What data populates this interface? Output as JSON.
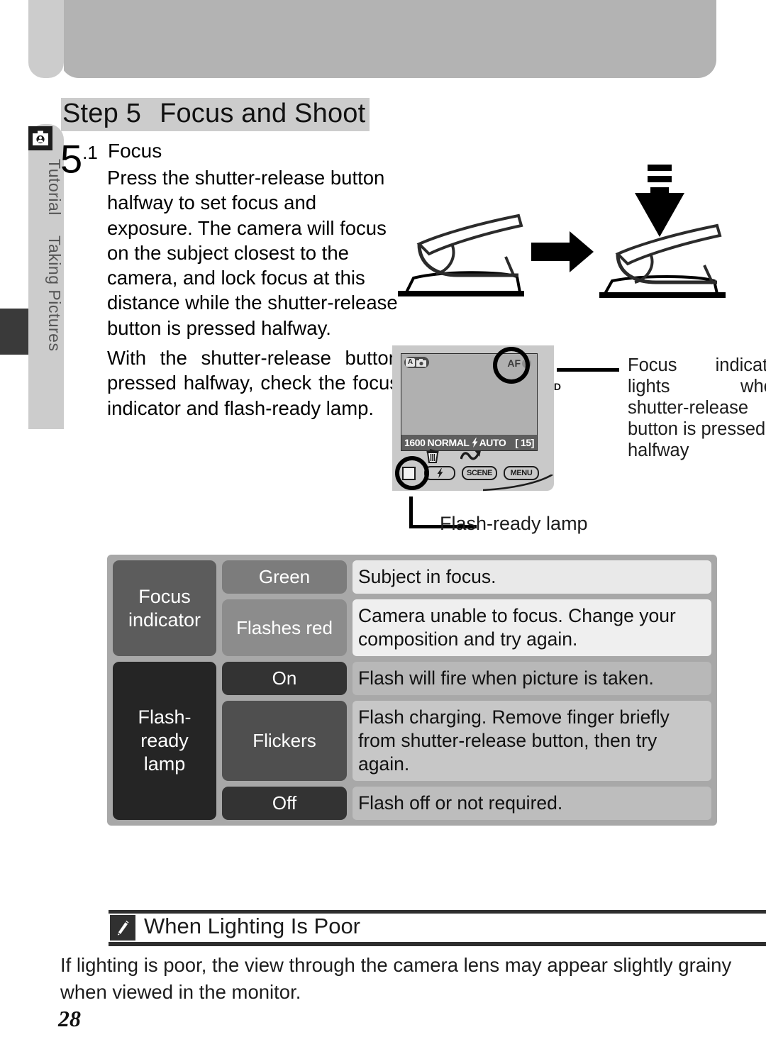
{
  "sidebar": {
    "camera_icon": "camera-icon",
    "labels": [
      "Tutorial",
      "Taking Pictures"
    ]
  },
  "step": {
    "header_label": "Step 5",
    "header_title": "Focus and Shoot",
    "number": "5",
    "number_sub": ".1",
    "title": "Focus",
    "paragraph1": "Press the shutter-release button halfway to set focus and exposure.  The camera will focus on the subject closest to the camera, and lock focus at this distance while the shutter-release button is pressed halfway.",
    "paragraph2": "With the shutter-release button pressed halfway, check the focus indicator and flash-ready lamp."
  },
  "camera": {
    "lcd": {
      "mode_badge_letter": "A",
      "mode_badge_icon": "camera-icon",
      "af_label": "AF",
      "af_dot": "focus-dot-icon",
      "right_marker": "D",
      "status": {
        "resolution": "1600",
        "quality": "NORMAL",
        "flash_icon": "flash-icon",
        "flash_mode": "AUTO",
        "frames_remaining": "[   15]"
      }
    },
    "buttons": {
      "monitor": "monitor-button",
      "flash": "flash-icon",
      "scene": "SCENE",
      "menu": "MENU",
      "trash": "trash-icon",
      "transfer": "transfer-icon"
    }
  },
  "callouts": {
    "focus_indicator": {
      "line1": "Focus indicator",
      "line2": "lights when",
      "line3": "shutter-release",
      "line4": "button is pressed",
      "line5": "halfway"
    },
    "flash_ready_lamp": "Flash-ready lamp"
  },
  "table": {
    "groups": [
      {
        "label": "Focus\nindicator",
        "label_line1": "Focus",
        "label_line2": "indicator",
        "rows": [
          {
            "state": "Green",
            "desc": "Subject in focus."
          },
          {
            "state": "Flashes red",
            "desc": "Camera unable to focus.  Change your composition and try again."
          }
        ]
      },
      {
        "label_line1": "Flash-",
        "label_line2": "ready",
        "label_line3": "lamp",
        "rows": [
          {
            "state": "On",
            "desc": "Flash will fire when picture is taken."
          },
          {
            "state": "Flickers",
            "desc": "Flash charging.  Remove finger briefly from shutter-release button, then try again."
          },
          {
            "state": "Off",
            "desc": "Flash off or not required."
          }
        ]
      }
    ]
  },
  "note": {
    "icon": "pencil-icon",
    "title": "When Lighting Is Poor",
    "body": "If lighting is poor, the view through the camera lens may appear slightly  grainy  when viewed in the monitor."
  },
  "page_number": "28",
  "colors": {
    "banner": "#b3b3b3",
    "rail": "#cccccc",
    "table_bg": "#a8a8a8",
    "focus_label": "#5c5c5c",
    "flash_label": "#252525"
  }
}
